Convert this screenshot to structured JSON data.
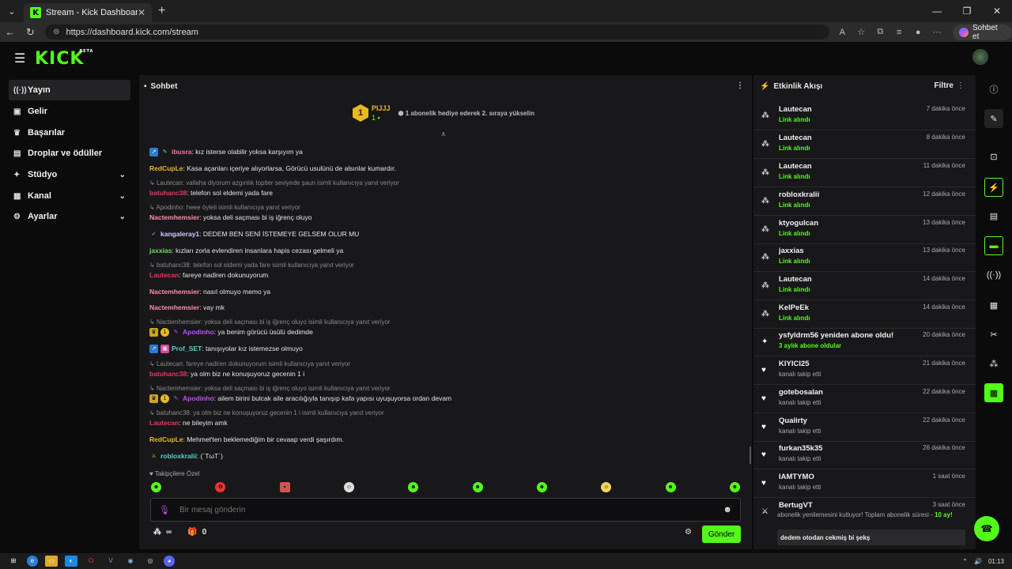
{
  "browser": {
    "tab_title": "Stream - Kick Dashboard",
    "url": "https://dashboard.kick.com/stream",
    "copilot_label": "Sohbet et",
    "favicon_letter": "K"
  },
  "app": {
    "logo": "KICK",
    "logo_badge": "BETA"
  },
  "sidebar": {
    "items": [
      {
        "label": "Yayın"
      },
      {
        "label": "Gelir"
      },
      {
        "label": "Başarılar"
      },
      {
        "label": "Droplar ve ödüller"
      },
      {
        "label": "Stüdyo"
      },
      {
        "label": "Kanal"
      },
      {
        "label": "Ayarlar"
      }
    ]
  },
  "chat": {
    "title": "Sohbet",
    "pinned": {
      "rank": "1",
      "user": "PIJJJ",
      "count": "1",
      "text": "1 abonelik hediye ederek 2. sıraya yükselin"
    },
    "messages": [
      {
        "user": "ibusra",
        "text": ": kız isterse olabilir yoksa karşıyım ya",
        "color": "#ff6fa8"
      },
      {
        "user": "RedCupLe",
        "text": ": Kasa açanları içeriye alıyorlarsa, Görücü usulünü de alsınlar kumardır.",
        "color": "#e8b923"
      },
      {
        "reply": "Lautecan: vallaha diyorum azgınlık toptier seviyede şaun isimli kullanıcıya yanıt veriyor",
        "user": "batuhanc38",
        "text": ": telefon sol eldemi yada fare",
        "color": "#e5365f"
      },
      {
        "reply": "Apodinho: heee öyleli isimli kullanıcıya yanıt veriyor",
        "user": "Nactemhemsier",
        "text": ": yoksa deli saçması bi iş iğrenç oluyo",
        "color": "#ff8fa0"
      },
      {
        "user": "kangaleray1",
        "text": ": DEDEM BEN SENİ İSTEMEYE GELSEM OLUR MU",
        "color": "#d8c7ff"
      },
      {
        "user": "jaxxias",
        "text": ": kızları zorla evlendiren insanlara hapis cezası gelmeli ya",
        "color": "#7bd86b"
      },
      {
        "reply": "batuhanc38: telefon sol eldemi yada fare isimli kullanıcıya yanıt veriyor",
        "user": "Lautecan",
        "text": ": fareye nadiren dokunuyorum",
        "color": "#e5365f"
      },
      {
        "user": "Nactemhemsier",
        "text": ": nasıl olmuyo memo ya",
        "color": "#ff8fa0"
      },
      {
        "user": "Nactemhemsier",
        "text": ": vay mk",
        "color": "#ff8fa0"
      },
      {
        "reply": "Nactemhemsier: yoksa deli saçması bi iş iğrenç oluyo  isimli kullanıcıya yanıt veriyor",
        "user": "Apodinho",
        "text": ": ya benim görücü üsülü dedimde",
        "color": "#c34ff0"
      },
      {
        "user": "Prof_SET",
        "text": ": tanışıyolar kız istemezse olmuyo",
        "color": "#5ad1c6"
      },
      {
        "reply": "Lautecan: fareye nadiren dokunuyorum isimli kullanıcıya yanıt veriyor",
        "user": "batuhanc38",
        "text": ": ya olm biz ne konuşuyoruz gecenin 1 i",
        "color": "#e5365f"
      },
      {
        "reply": "Nactemhemsier: yoksa deli saçması bi iş iğrenç oluyo  isimli kullanıcıya yanıt veriyor",
        "user": "Apodinho",
        "text": ": ailem birini bulcak aile aracılığıyla tanışıp kafa yapısı uyuşuyorsa ordan devam",
        "color": "#c34ff0"
      },
      {
        "reply": "batuhanc38: ya olm biz ne konuşuyoruz gecenin 1 i isimli kullanıcıya yanıt veriyor",
        "user": "Lautecan",
        "text": ": ne bileyim amk",
        "color": "#e5365f"
      },
      {
        "user": "RedCupLe",
        "text": ": Mehmet'ten beklemediğim bir cevaap verdi şaşırdım.",
        "color": "#e8b923"
      },
      {
        "user": "robloxkralii",
        "text": ": (´TωT`)",
        "color": "#5ad1c6"
      }
    ],
    "followers_label": "Takipçilere Özel",
    "input_placeholder": "Bir mesaj gönderin",
    "viewer_count": "∞",
    "gift_count": "0",
    "send_label": "Gönder"
  },
  "activity": {
    "title": "Etkinlik Akışı",
    "filter_label": "Filtre",
    "items": [
      {
        "name": "Lautecan",
        "sub": "Link alındı",
        "time": "7 dakika önce",
        "icon": "people-icon"
      },
      {
        "name": "Lautecan",
        "sub": "Link alındı",
        "time": "8 dakika önce",
        "icon": "people-icon"
      },
      {
        "name": "Lautecan",
        "sub": "Link alındı",
        "time": "11 dakika önce",
        "icon": "people-icon"
      },
      {
        "name": "robloxkralii",
        "sub": "Link alındı",
        "time": "12 dakika önce",
        "icon": "people-icon"
      },
      {
        "name": "ktyogulcan",
        "sub": "Link alındı",
        "time": "13 dakika önce",
        "icon": "people-icon"
      },
      {
        "name": "jaxxias",
        "sub": "Link alındı",
        "time": "13 dakika önce",
        "icon": "people-icon"
      },
      {
        "name": "Lautecan",
        "sub": "Link alındı",
        "time": "14 dakika önce",
        "icon": "people-icon"
      },
      {
        "name": "KelPeEk",
        "sub": "Link alındı",
        "time": "14 dakika önce",
        "icon": "people-icon"
      },
      {
        "name": "ysfyldrm56 yeniden abone oldu!",
        "sub": "3 aylık abone oldular",
        "time": "20 dakika önce",
        "icon": "sparkle-icon"
      },
      {
        "name": "KIYICI25",
        "sub": "kanalı takip etti",
        "time": "21 dakika önce",
        "icon": "heart-icon"
      },
      {
        "name": "gotebosalan",
        "sub": "kanalı takip etti",
        "time": "22 dakika önce",
        "icon": "heart-icon"
      },
      {
        "name": "Qualirty",
        "sub": "kanalı takip etti",
        "time": "22 dakika önce",
        "icon": "heart-icon"
      },
      {
        "name": "furkan35k35",
        "sub": "kanalı takip etti",
        "time": "26 dakika önce",
        "icon": "heart-icon"
      },
      {
        "name": "IAMTYMO",
        "sub": "kanalı takip etti",
        "time": "1 saat önce",
        "icon": "heart-icon"
      }
    ],
    "last": {
      "name": "BertugVT",
      "time": "3 saat önce",
      "note_a": "abonelik yenilemesini kutluyor! Toplam abonelik süresi - ",
      "note_b": "10 ay!",
      "message": "dedem otodan cekmiş bi şekş"
    }
  },
  "taskbar": {
    "time": "01:13"
  },
  "colors": {
    "accent": "#53fc18",
    "panel": "#18181b",
    "bg": "#0b0b0c"
  }
}
